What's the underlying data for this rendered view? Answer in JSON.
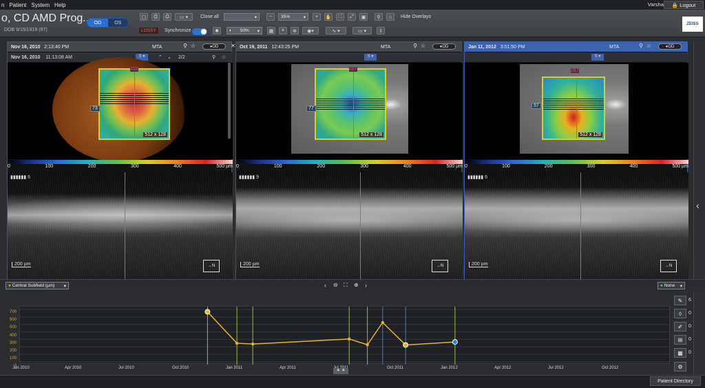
{
  "menu": {
    "items": [
      "n",
      "Patient",
      "System",
      "Help"
    ]
  },
  "header": {
    "user": "Varsha",
    "logout": "Logout",
    "patient_title": "o, CD AMD Prog...",
    "dob": "DOB 9/15/1919  (97)",
    "eye_od": "OD",
    "eye_os": "OS",
    "brand": "ZEISS"
  },
  "toolbar": {
    "close_all": "Close all",
    "zoom_value": "35%",
    "hide_overlays": "Hide Overlays",
    "lossy": "LOSSY",
    "synchronize": "Synchronize",
    "opacity_value": "50%"
  },
  "panels": [
    {
      "date": "Nov 16, 2010",
      "time": "2:13:40 PM",
      "mta": "MTA",
      "eye": "OD",
      "sub_date": "Nov 16, 2010",
      "sub_time": "11:13:08 AM",
      "page": "2/2",
      "left_val": "73",
      "top_val": "202",
      "size": "512 x 128",
      "frame": "6",
      "scale": "200 µm",
      "orient": "N"
    },
    {
      "date": "Oct 19, 2011",
      "time": "12:43:25 PM",
      "mta": "MTA",
      "eye": "OD",
      "left_val": "77",
      "top_val": "287",
      "size": "512 x 128",
      "frame": "9",
      "scale": "200 µm",
      "orient": "N"
    },
    {
      "date": "Jan 11, 2012",
      "time": "3:51:50 PM",
      "mta": "MTA",
      "eye": "OD",
      "left_val": "57",
      "top_val": "267",
      "size": "512 x 128",
      "frame": "6",
      "scale": "200 µm",
      "orient": "N"
    }
  ],
  "colorscale": {
    "labels": [
      "0",
      "100",
      "200",
      "300",
      "400",
      "500 µm"
    ]
  },
  "graph": {
    "selector": "Central Subfield (µm)",
    "none_label": "None",
    "ylabels": [
      "700",
      "600",
      "500",
      "400",
      "300",
      "200",
      "100",
      "0"
    ],
    "xlabels": [
      "Jan 2010",
      "Apr 2010",
      "Jul 2010",
      "Oct 2010",
      "Jan 2011",
      "Apr 2011",
      "Jul 2011",
      "Oct 2011",
      "Jan 2012",
      "Apr 2012",
      "Jul 2012",
      "Oct 2012"
    ],
    "side_counts": [
      "6",
      "0",
      "0",
      "0",
      "0"
    ]
  },
  "chart_data": {
    "type": "line",
    "x": [
      "2010-11-16",
      "2011-01-05",
      "2011-02-01",
      "2011-07-15",
      "2011-08-15",
      "2011-09-10",
      "2011-10-19",
      "2012-01-11"
    ],
    "series": [
      {
        "values": [
          668,
          248,
          238,
          305,
          228,
          525,
          225,
          265
        ]
      }
    ],
    "ylim": [
      0,
      700
    ],
    "xlim": [
      "2010-01-01",
      "2012-12-31"
    ],
    "line_color": "#e8b62c",
    "marker_colors": {
      "selected": "#2f7fd8"
    }
  },
  "footer": {
    "patient_directory": "Patient Directory"
  }
}
